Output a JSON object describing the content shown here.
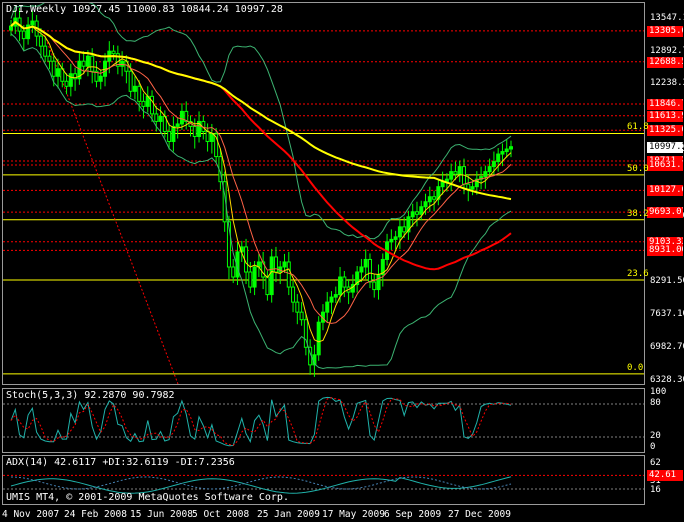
{
  "main": {
    "header": "DJI,Weekly  10927.45 11000.83 10844.24 10997.28",
    "copyright": "UMIS MT4, © 2001-2009 MetaQuotes Software Corp."
  },
  "price_axis": {
    "labels": [
      {
        "text": "13547.1",
        "price": 13547.1
      },
      {
        "text": "12892.7",
        "price": 12892.7
      },
      {
        "text": "12238.3",
        "price": 12238.3
      },
      {
        "text": "10929.5",
        "price": 10929.5
      },
      {
        "text": "9600.30",
        "price": 9600.3
      },
      {
        "text": "8291.50",
        "price": 8291.5
      },
      {
        "text": "7637.10",
        "price": 7637.1
      },
      {
        "text": "6982.70",
        "price": 6982.7
      },
      {
        "text": "6328.30",
        "price": 6328.3
      }
    ],
    "current_tag": {
      "text": "10997.28",
      "price": 10997.28,
      "bg": "#ffffff",
      "fg": "#000000"
    },
    "red_tags": [
      {
        "text": "13305.6",
        "price": 13305.6
      },
      {
        "text": "12688.5",
        "price": 12688.5
      },
      {
        "text": "11846.7",
        "price": 11846.7
      },
      {
        "text": "11613.9",
        "price": 11613.9
      },
      {
        "text": "11325.0",
        "price": 11325.0
      },
      {
        "text": "10711.7",
        "price": 10711.7
      },
      {
        "text": "10631.7",
        "price": 10631.7
      },
      {
        "text": "10127.0",
        "price": 10127.0
      },
      {
        "text": "9693.07",
        "price": 9693.07
      },
      {
        "text": "9103.33",
        "price": 9103.33
      },
      {
        "text": "8931.00",
        "price": 8931.0
      }
    ]
  },
  "fib_levels": [
    {
      "label": "61.8",
      "price": 11260
    },
    {
      "label": "50.0",
      "price": 10435
    },
    {
      "label": "38.2",
      "price": 9540
    },
    {
      "label": "23.6",
      "price": 8340
    },
    {
      "label": "0.0",
      "price": 6470
    }
  ],
  "date_axis": [
    "4 Nov 2007",
    "24 Feb 2008",
    "15 Jun 2008",
    "5 Oct 2008",
    "25 Jan 2009",
    "17 May 2009",
    "6 Sep 2009",
    "27 Dec 2009"
  ],
  "stoch": {
    "header": "Stoch(5,3,3) 92.2870 90.7982",
    "axis": [
      "100",
      "80",
      "20",
      "0"
    ]
  },
  "adx": {
    "header": "ADX(14) 42.6117 +DI:32.6119 -DI:7.2356",
    "axis": [
      "62",
      "31",
      "16"
    ],
    "red_tag": "42.61"
  },
  "colors": {
    "bull_candle": "#00ff00",
    "bear_candle": "#00ff00",
    "ma_long": "#ff0000",
    "ma_200": "#ffff00",
    "bollinger": "#3cb371",
    "fib": "#ffff00",
    "levels": "#ff0000",
    "stoch_main": "#20b2aa",
    "stoch_signal": "#ff0000"
  },
  "chart_data": {
    "type": "candlestick",
    "symbol": "DJI",
    "timeframe": "Weekly",
    "ylim": [
      6328.3,
      13800
    ],
    "weeks": 118,
    "closes": [
      13400,
      13560,
      13300,
      13150,
      13420,
      13500,
      13200,
      13000,
      12800,
      12700,
      12400,
      12550,
      12300,
      12200,
      12450,
      12350,
      12700,
      12600,
      12800,
      12500,
      12300,
      12400,
      12700,
      12900,
      12850,
      12600,
      12700,
      12500,
      12100,
      12200,
      11900,
      11800,
      12000,
      11650,
      11500,
      11600,
      11300,
      11100,
      11400,
      11450,
      11700,
      11500,
      11400,
      11200,
      11500,
      11300,
      11100,
      11250,
      10800,
      10300,
      9500,
      8600,
      8400,
      8900,
      9000,
      8500,
      8200,
      8600,
      8700,
      8400,
      8050,
      8800,
      8500,
      8600,
      8700,
      8200,
      7900,
      7700,
      7550,
      7000,
      6650,
      6850,
      7500,
      7700,
      7900,
      8000,
      8050,
      8400,
      8200,
      8100,
      8250,
      8500,
      8600,
      8750,
      8300,
      8150,
      8450,
      8750,
      9100,
      9150,
      9200,
      9400,
      9300,
      9600,
      9700,
      9650,
      9800,
      9900,
      10000,
      9950,
      10200,
      10300,
      10350,
      10500,
      10450,
      10600,
      10250,
      10150,
      10200,
      10350,
      10400,
      10500,
      10600,
      10700,
      10850,
      10900,
      10950,
      10997
    ]
  }
}
